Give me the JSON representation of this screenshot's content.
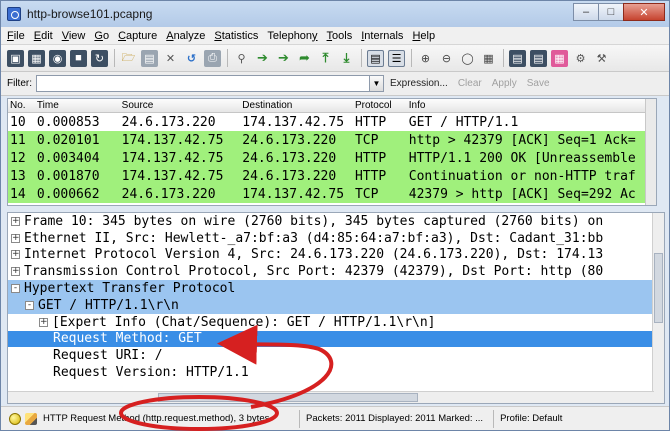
{
  "window": {
    "title": "http-browse101.pcapng"
  },
  "menu": [
    {
      "pre": "",
      "u": "F",
      "post": "ile"
    },
    {
      "pre": "",
      "u": "E",
      "post": "dit"
    },
    {
      "pre": "",
      "u": "V",
      "post": "iew"
    },
    {
      "pre": "",
      "u": "G",
      "post": "o"
    },
    {
      "pre": "",
      "u": "C",
      "post": "apture"
    },
    {
      "pre": "",
      "u": "A",
      "post": "nalyze"
    },
    {
      "pre": "",
      "u": "S",
      "post": "tatistics"
    },
    {
      "pre": "Telephon",
      "u": "y",
      "post": ""
    },
    {
      "pre": "",
      "u": "T",
      "post": "ools"
    },
    {
      "pre": "",
      "u": "I",
      "post": "nternals"
    },
    {
      "pre": "",
      "u": "H",
      "post": "elp"
    }
  ],
  "toolbar_icons": [
    "interface-list-icon",
    "capture-options-icon",
    "start-capture-icon",
    "stop-capture-icon",
    "restart-capture-icon",
    "open-file-icon",
    "save-file-icon",
    "close-file-icon",
    "reload-icon",
    "print-icon",
    "find-packet-icon",
    "go-back-icon",
    "go-forward-icon",
    "go-to-packet-icon",
    "go-first-icon",
    "go-last-icon",
    "colorize-icon",
    "auto-scroll-icon",
    "zoom-in-icon",
    "zoom-out-icon",
    "normal-size-icon",
    "resize-columns-icon",
    "capture-filters-icon",
    "display-filters-icon",
    "coloring-rules-icon",
    "preferences-icon",
    "help-icon"
  ],
  "filter": {
    "label": "Filter:",
    "value": "",
    "expression": "Expression...",
    "clear": "Clear",
    "apply": "Apply",
    "save": "Save"
  },
  "packet_columns": {
    "no": "No.",
    "time": "Time",
    "source": "Source",
    "destination": "Destination",
    "protocol": "Protocol",
    "info": "Info"
  },
  "packets": [
    {
      "no": "10",
      "time": "0.000853",
      "source": "24.6.173.220",
      "destination": "174.137.42.75",
      "protocol": "HTTP",
      "info": "GET / HTTP/1.1",
      "color": "white"
    },
    {
      "no": "11",
      "time": "0.020101",
      "source": "174.137.42.75",
      "destination": "24.6.173.220",
      "protocol": "TCP",
      "info": "http > 42379 [ACK] Seq=1 Ack=",
      "color": "green"
    },
    {
      "no": "12",
      "time": "0.003404",
      "source": "174.137.42.75",
      "destination": "24.6.173.220",
      "protocol": "HTTP",
      "info": "HTTP/1.1 200 OK [Unreassemble",
      "color": "green"
    },
    {
      "no": "13",
      "time": "0.001870",
      "source": "174.137.42.75",
      "destination": "24.6.173.220",
      "protocol": "HTTP",
      "info": "Continuation or non-HTTP traf",
      "color": "green"
    },
    {
      "no": "14",
      "time": "0.000662",
      "source": "24.6.173.220",
      "destination": "174.137.42.75",
      "protocol": "TCP",
      "info": "42379 > http [ACK] Seq=292 Ac",
      "color": "green"
    }
  ],
  "details": [
    {
      "text": "Frame 10: 345 bytes on wire (2760 bits), 345 bytes captured (2760 bits) on",
      "indent": 0,
      "expander": "+",
      "highlight": "none"
    },
    {
      "text": "Ethernet II, Src: Hewlett-_a7:bf:a3 (d4:85:64:a7:bf:a3), Dst: Cadant_31:bb",
      "indent": 0,
      "expander": "+",
      "highlight": "none"
    },
    {
      "text": "Internet Protocol Version 4, Src: 24.6.173.220 (24.6.173.220), Dst: 174.13",
      "indent": 0,
      "expander": "+",
      "highlight": "none"
    },
    {
      "text": "Transmission Control Protocol, Src Port: 42379 (42379), Dst Port: http (80",
      "indent": 0,
      "expander": "+",
      "highlight": "none"
    },
    {
      "text": "Hypertext Transfer Protocol",
      "indent": 0,
      "expander": "-",
      "highlight": "light"
    },
    {
      "text": "GET / HTTP/1.1\\r\\n",
      "indent": 1,
      "expander": "-",
      "highlight": "light"
    },
    {
      "text": "[Expert Info (Chat/Sequence): GET / HTTP/1.1\\r\\n]",
      "indent": 2,
      "expander": "+",
      "highlight": "none"
    },
    {
      "text": "Request Method: GET",
      "indent": 3,
      "expander": "",
      "highlight": "dark"
    },
    {
      "text": "Request URI: /",
      "indent": 3,
      "expander": "",
      "highlight": "none"
    },
    {
      "text": "Request Version: HTTP/1.1",
      "indent": 3,
      "expander": "",
      "highlight": "none"
    }
  ],
  "status": {
    "field": "HTTP Request Method (http.request.method), 3 bytes",
    "packets": "Packets: 2011 Displayed: 2011 Marked: ...",
    "profile": "Profile: Default"
  },
  "colors": {
    "green_row": "#a0f07c",
    "selected_row": "#3a8ee6",
    "expanded_row": "#9bc5f0",
    "annotation": "#d62020"
  }
}
